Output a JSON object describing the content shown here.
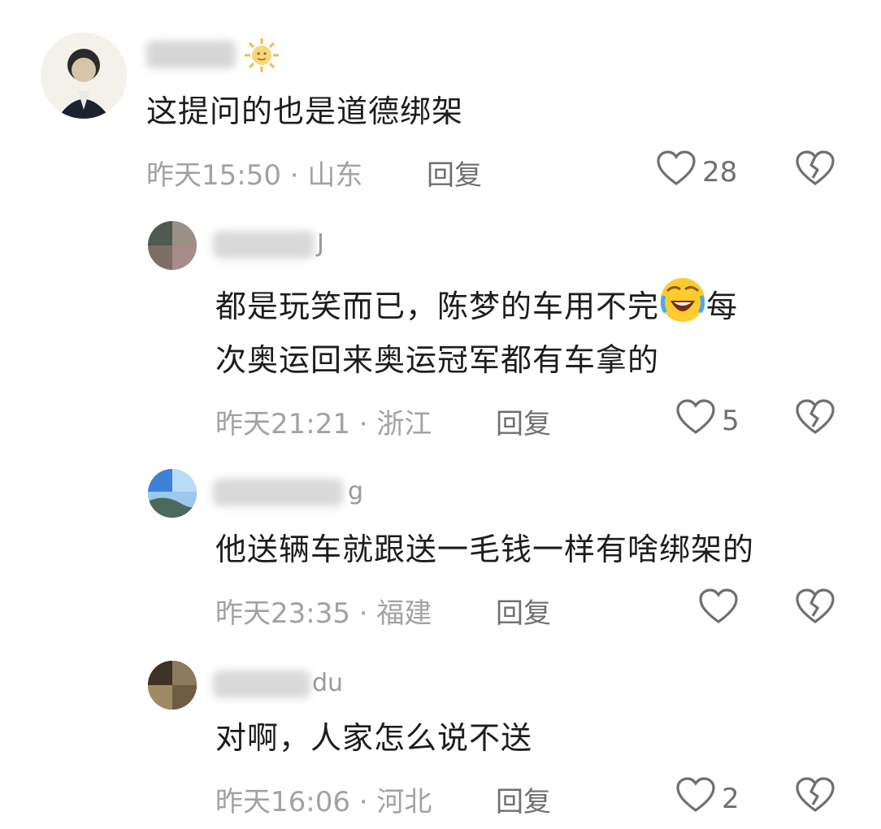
{
  "comments": [
    {
      "text": "这提问的也是道德绑架",
      "meta": "昨天15:50 · 山东",
      "reply": "回复",
      "likes": "28"
    },
    {
      "name_tail": "J",
      "text_a": "都是玩笑而已，陈梦的车用不完",
      "text_b": "每",
      "text_c": "次奥运回来奥运冠军都有车拿的",
      "meta": "昨天21:21 · 浙江",
      "reply": "回复",
      "likes": "5"
    },
    {
      "name_tail": "g",
      "text": "他送辆车就跟送一毛钱一样有啥绑架的",
      "meta": "昨天23:35 · 福建",
      "reply": "回复",
      "likes": ""
    },
    {
      "name_tail": "du",
      "text": "对啊，人家怎么说不送",
      "meta": "昨天16:06 · 河北",
      "reply": "回复",
      "likes": "2"
    }
  ]
}
